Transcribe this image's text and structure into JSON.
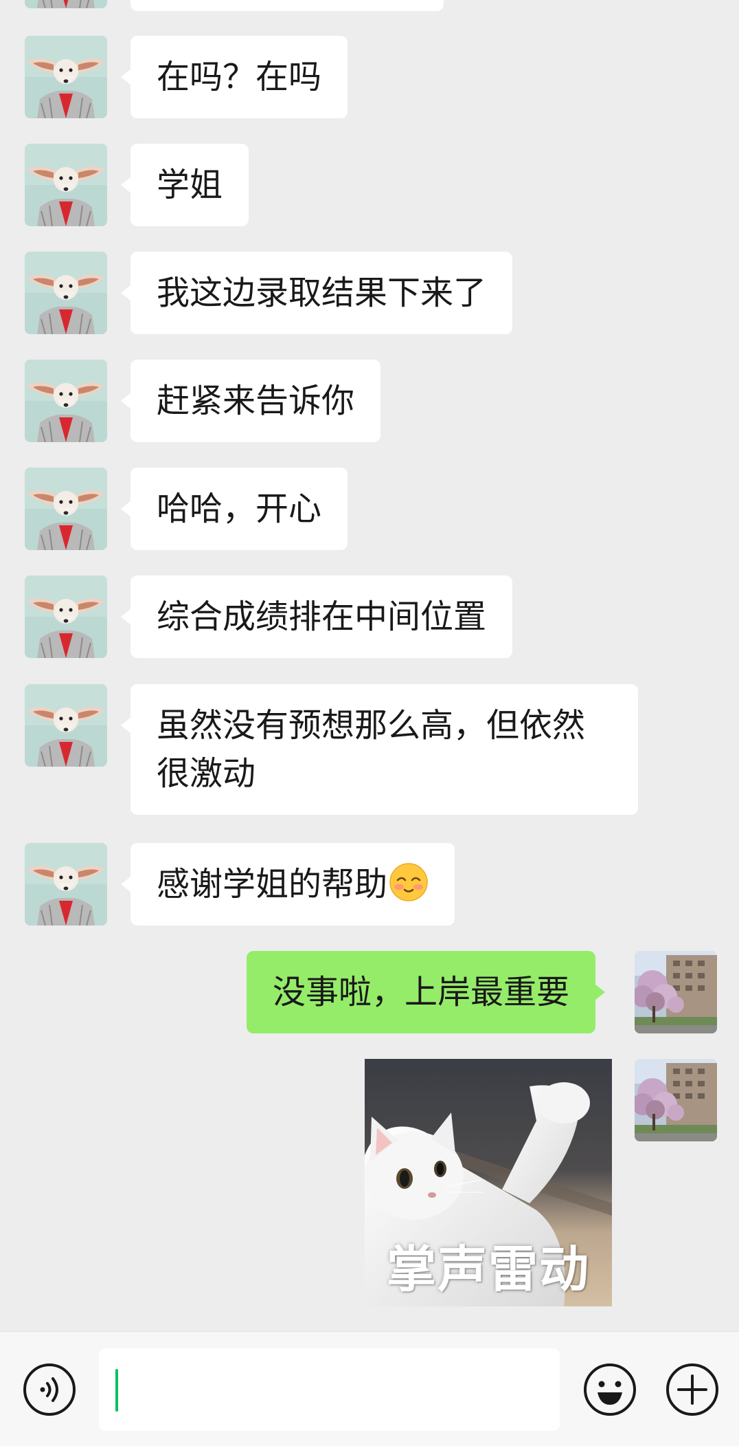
{
  "chat": {
    "incoming": [
      {
        "text": "在吗？在吗"
      },
      {
        "text": "学姐"
      },
      {
        "text": "我这边录取结果下来了"
      },
      {
        "text": "赶紧来告诉你"
      },
      {
        "text": "哈哈，开心"
      },
      {
        "text": "综合成绩排在中间位置"
      },
      {
        "text": "虽然没有预想那么高，但依然很激动"
      },
      {
        "text": "感谢学姐的帮助",
        "emoji": "blushing-smile-emoji"
      }
    ],
    "outgoing": [
      {
        "text": "没事啦，上岸最重要"
      }
    ],
    "sticker": {
      "caption": "掌声雷动",
      "icon": "clapping-cat-sticker"
    }
  },
  "avatars": {
    "contact": "fennec-fox-avatar",
    "self": "campus-blossom-avatar"
  },
  "input_bar": {
    "voice_icon": "voice-icon",
    "emoji_icon": "emoji-icon",
    "more_icon": "plus-icon",
    "value": "",
    "placeholder": ""
  },
  "colors": {
    "background": "#ededed",
    "incoming_bubble": "#ffffff",
    "outgoing_bubble": "#95ec69",
    "text": "#191919",
    "caret": "#07c160"
  }
}
